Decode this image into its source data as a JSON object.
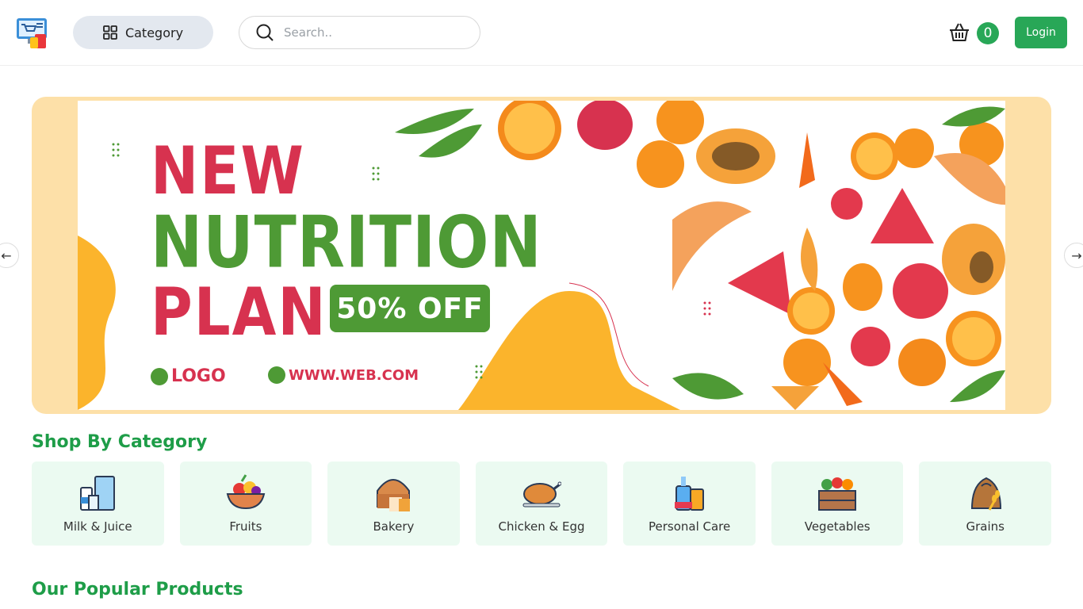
{
  "header": {
    "category_label": "Category",
    "search_placeholder": "Search..",
    "cart_count": "0",
    "login_label": "Login"
  },
  "banner": {
    "line1": "NEW",
    "line2": "NUTRITION",
    "line3": "PLAN",
    "offer": "50% OFF",
    "logo_text": "LOGO",
    "website": "WWW.WEB.COM"
  },
  "shop_by_category": {
    "title": "Shop By Category",
    "items": [
      {
        "label": "Milk & Juice",
        "icon": "milk-juice-icon"
      },
      {
        "label": "Fruits",
        "icon": "fruits-icon"
      },
      {
        "label": "Bakery",
        "icon": "bakery-icon"
      },
      {
        "label": "Chicken & Egg",
        "icon": "chicken-egg-icon"
      },
      {
        "label": "Personal Care",
        "icon": "personal-care-icon"
      },
      {
        "label": "Vegetables",
        "icon": "vegetables-icon"
      },
      {
        "label": "Grains",
        "icon": "grains-icon"
      }
    ]
  },
  "popular": {
    "title": "Our Popular Products"
  },
  "colors": {
    "brand_green": "#28a757",
    "title_green": "#1e9d48",
    "category_bg": "#ebfaf1",
    "banner_red": "#d7324f",
    "banner_green": "#4e9a35"
  }
}
